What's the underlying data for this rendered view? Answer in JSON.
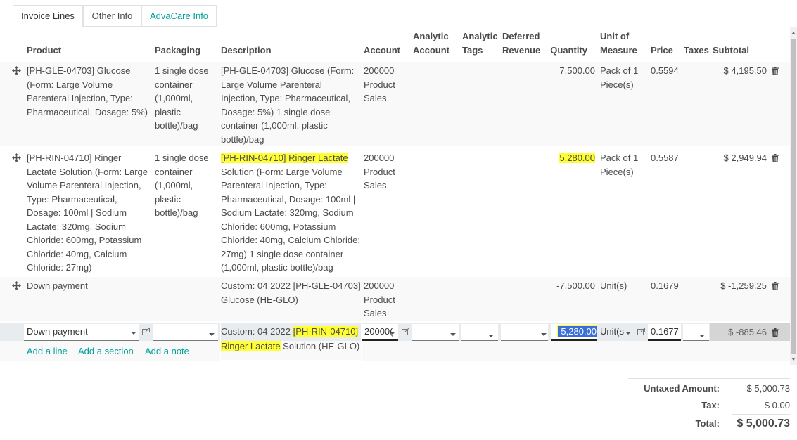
{
  "tabs": [
    "Invoice Lines",
    "Other Info",
    "AdvaCare Info"
  ],
  "columns": {
    "product": "Product",
    "packaging": "Packaging",
    "description": "Description",
    "account": "Account",
    "analytic_account": [
      "Analytic",
      "Account"
    ],
    "analytic_tags": [
      "Analytic",
      "Tags"
    ],
    "deferred_revenue": [
      "Deferred",
      "Revenue"
    ],
    "quantity": "Quantity",
    "uom": [
      "Unit of",
      "Measure"
    ],
    "price": "Price",
    "taxes": "Taxes",
    "subtotal": "Subtotal"
  },
  "rows": [
    {
      "product": [
        "[PH-GLE-04703] Glucose",
        "(Form: Large Volume",
        "Parenteral Injection, Type:",
        "Pharmaceutical, Dosage: 5%)"
      ],
      "packaging": [
        "1 single dose",
        "container",
        "(1,000ml,",
        "plastic",
        "bottle)/bag"
      ],
      "description": [
        "[PH-GLE-04703] Glucose (Form:",
        "Large Volume Parenteral",
        "Injection, Type: Pharmaceutical,",
        "Dosage: 5%) 1 single dose",
        "container (1,000ml, plastic",
        "bottle)/bag"
      ],
      "account": [
        "200000",
        "Product",
        "Sales"
      ],
      "quantity": "7,500.00",
      "uom": [
        "Pack of 1",
        "Piece(s)"
      ],
      "price": "0.5594",
      "subtotal": "$ 4,195.50"
    },
    {
      "product": [
        "[PH-RIN-04710] Ringer",
        "Lactate Solution (Form: Large",
        "Volume Parenteral Injection,",
        "Type: Pharmaceutical,",
        "Dosage: 100ml | Sodium",
        "Lactate: 320mg, Sodium",
        "Chloride: 600mg, Potassium",
        "Chloride: 40mg, Calcium",
        "Chloride: 27mg)"
      ],
      "packaging": [
        "1 single dose",
        "container",
        "(1,000ml,",
        "plastic",
        "bottle)/bag"
      ],
      "description_highlight": "[PH-RIN-04710] Ringer Lactate",
      "description": [
        "Solution (Form: Large Volume",
        "Parenteral Injection, Type:",
        "Pharmaceutical, Dosage: 100ml |",
        "Sodium Lactate: 320mg, Sodium",
        "Chloride: 600mg, Potassium",
        "Chloride: 40mg, Calcium Chloride:",
        "27mg) 1 single dose container",
        "(1,000ml, plastic bottle)/bag"
      ],
      "account": [
        "200000",
        "Product",
        "Sales"
      ],
      "quantity": "5,280.00",
      "uom": [
        "Pack of 1",
        "Piece(s)"
      ],
      "price": "0.5587",
      "subtotal": "$ 2,949.94"
    },
    {
      "product": [
        "Down payment"
      ],
      "description": [
        "Custom: 04 2022 [PH-GLE-04703]",
        "Glucose (HE-GLO)"
      ],
      "account": [
        "200000",
        "Product",
        "Sales"
      ],
      "quantity": "-7,500.00",
      "uom": [
        "Unit(s)"
      ],
      "price": "0.1679",
      "subtotal": "$ -1,259.25"
    }
  ],
  "edit_row": {
    "product": "Down payment",
    "description_prefix": "Custom: 04 2022 ",
    "description_hl1": "[PH-RIN-04710]",
    "description_hl2": "Ringer Lactate",
    "description_suffix": " Solution (HE-GLO)",
    "account": "20000(",
    "quantity": "-5,280.00",
    "uom": "Unit(s",
    "price": "0.1677",
    "subtotal": "$ -885.46"
  },
  "actions": [
    "Add a line",
    "Add a section",
    "Add a note"
  ],
  "totals": {
    "untaxed_label": "Untaxed Amount:",
    "untaxed_value": "$ 5,000.73",
    "tax_label": "Tax:",
    "tax_value": "$ 0.00",
    "total_label": "Total:",
    "total_value": "$ 5,000.73"
  },
  "colors": {
    "accent": "#00a09d",
    "highlight": "#ffff33",
    "edit_row": "#e9ecef"
  }
}
